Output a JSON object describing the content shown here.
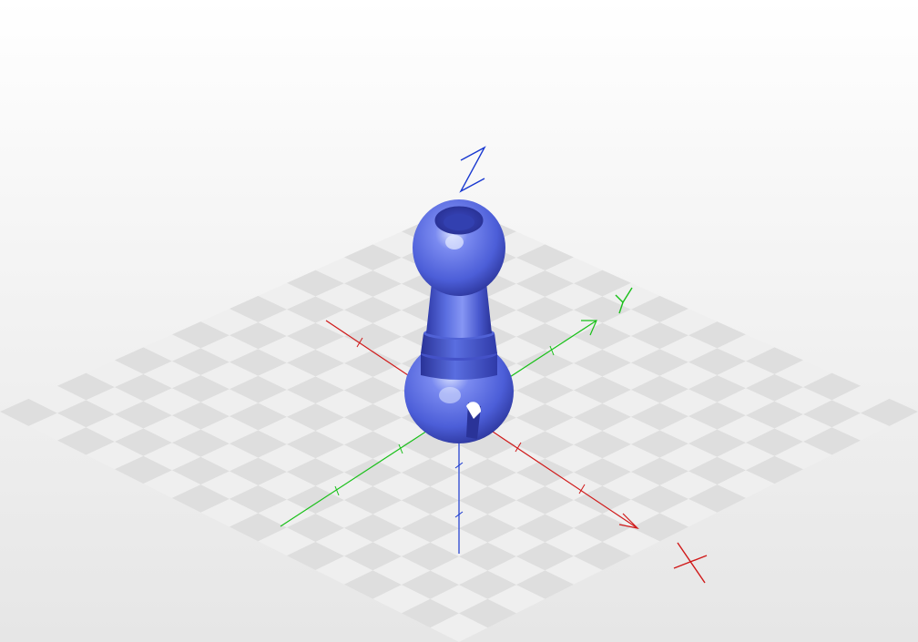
{
  "viewport": {
    "background": "#f2f2f2",
    "build_plate": {
      "grid_cells": 16,
      "checker_light": "#efefef",
      "checker_dark": "#dedede"
    },
    "axes": {
      "x": {
        "label": "X",
        "color": "#d01818",
        "ticks": 4
      },
      "y": {
        "label": "Y",
        "color": "#18c018",
        "ticks": 4
      },
      "z": {
        "label": "Z",
        "color": "#1838d0",
        "ticks": 2
      }
    },
    "model": {
      "name": "ball-joint-part",
      "color": "#5a6ee0",
      "shadow_color": "#2a3398",
      "highlight_color": "#d8e0ff"
    }
  }
}
